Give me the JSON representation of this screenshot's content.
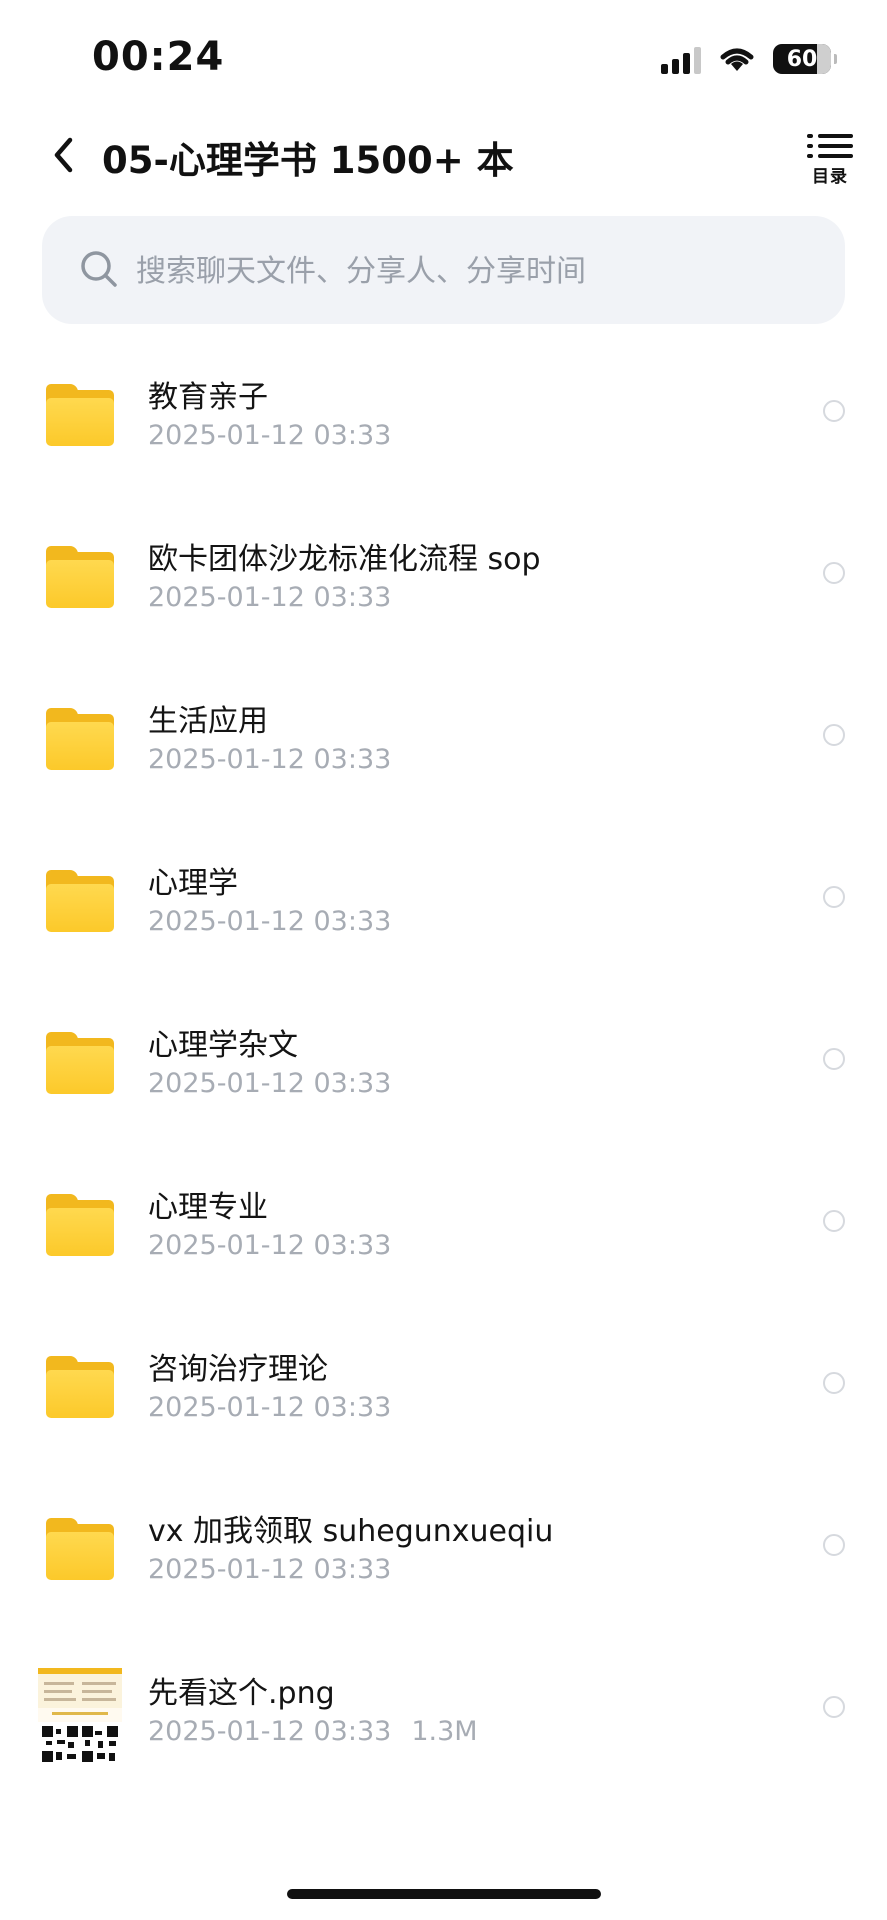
{
  "status_bar": {
    "time": "00:24",
    "battery": "60"
  },
  "header": {
    "title": "05-心理学书 1500+ 本",
    "toc_label": "目录"
  },
  "search": {
    "placeholder": "搜索聊天文件、分享人、分享时间"
  },
  "items": [
    {
      "name": "教育亲子",
      "date": "2025-01-12 03:33",
      "type": "folder"
    },
    {
      "name": "欧卡团体沙龙标准化流程 sop",
      "date": "2025-01-12 03:33",
      "type": "folder"
    },
    {
      "name": "生活应用",
      "date": "2025-01-12 03:33",
      "type": "folder"
    },
    {
      "name": "心理学",
      "date": "2025-01-12 03:33",
      "type": "folder"
    },
    {
      "name": "心理学杂文",
      "date": "2025-01-12 03:33",
      "type": "folder"
    },
    {
      "name": "心理专业",
      "date": "2025-01-12 03:33",
      "type": "folder"
    },
    {
      "name": "咨询治疗理论",
      "date": "2025-01-12 03:33",
      "type": "folder"
    },
    {
      "name": "vx 加我领取 suhegunxueqiu",
      "date": "2025-01-12 03:33",
      "type": "folder"
    },
    {
      "name": "先看这个.png",
      "date": "2025-01-12 03:33",
      "size": "1.3M",
      "type": "image"
    }
  ],
  "colors": {
    "folder": "#fcc92a",
    "meta_text": "#a7acb4",
    "search_bg": "#f1f3f7"
  }
}
